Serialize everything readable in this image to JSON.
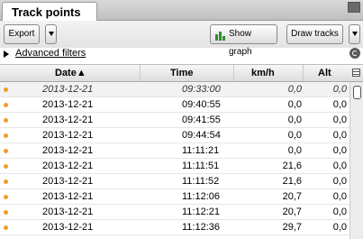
{
  "panel": {
    "tab_title": "Track points"
  },
  "toolbar": {
    "export_label": "Export",
    "show_graph_label": "Show graph",
    "draw_tracks_label": "Draw tracks"
  },
  "filters": {
    "advanced_label": "Advanced filters"
  },
  "table": {
    "columns": [
      "Date▲",
      "Time",
      "km/h",
      "Alt"
    ],
    "rows": [
      {
        "date": "2013-12-21",
        "time": "09:33:00",
        "speed": "0,0",
        "alt": "0,0"
      },
      {
        "date": "2013-12-21",
        "time": "09:40:55",
        "speed": "0,0",
        "alt": "0,0"
      },
      {
        "date": "2013-12-21",
        "time": "09:41:55",
        "speed": "0,0",
        "alt": "0,0"
      },
      {
        "date": "2013-12-21",
        "time": "09:44:54",
        "speed": "0,0",
        "alt": "0,0"
      },
      {
        "date": "2013-12-21",
        "time": "11:11:21",
        "speed": "0,0",
        "alt": "0,0"
      },
      {
        "date": "2013-12-21",
        "time": "11:11:51",
        "speed": "21,6",
        "alt": "0,0"
      },
      {
        "date": "2013-12-21",
        "time": "11:11:52",
        "speed": "21,6",
        "alt": "0,0"
      },
      {
        "date": "2013-12-21",
        "time": "11:12:06",
        "speed": "20,7",
        "alt": "0,0"
      },
      {
        "date": "2013-12-21",
        "time": "11:12:21",
        "speed": "20,7",
        "alt": "0,0"
      },
      {
        "date": "2013-12-21",
        "time": "11:12:36",
        "speed": "29,7",
        "alt": "0,0"
      }
    ]
  },
  "colors": {
    "marker": "#f39b2b",
    "selected_row": "#f2f2f2"
  }
}
